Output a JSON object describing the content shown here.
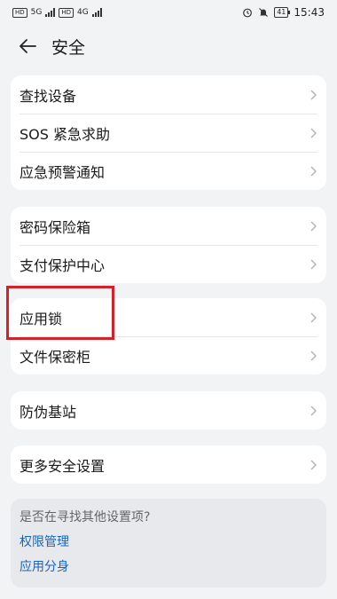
{
  "status": {
    "sim1": "HD",
    "sim2": "HD",
    "net1": "5G",
    "net2": "4G",
    "battery": "41",
    "time": "15:43"
  },
  "header": {
    "title": "安全"
  },
  "groups": [
    {
      "items": [
        "查找设备",
        "SOS 紧急求助",
        "应急预警通知"
      ]
    },
    {
      "items": [
        "密码保险箱",
        "支付保护中心"
      ]
    },
    {
      "items": [
        "应用锁",
        "文件保密柜"
      ]
    },
    {
      "items": [
        "防伪基站"
      ]
    },
    {
      "items": [
        "更多安全设置"
      ]
    }
  ],
  "suggest": {
    "question": "是否在寻找其他设置项?",
    "links": [
      "权限管理",
      "应用分身"
    ]
  },
  "colors": {
    "highlight": "#d2232a",
    "link": "#1565c0",
    "background": "#f1f3f5"
  }
}
